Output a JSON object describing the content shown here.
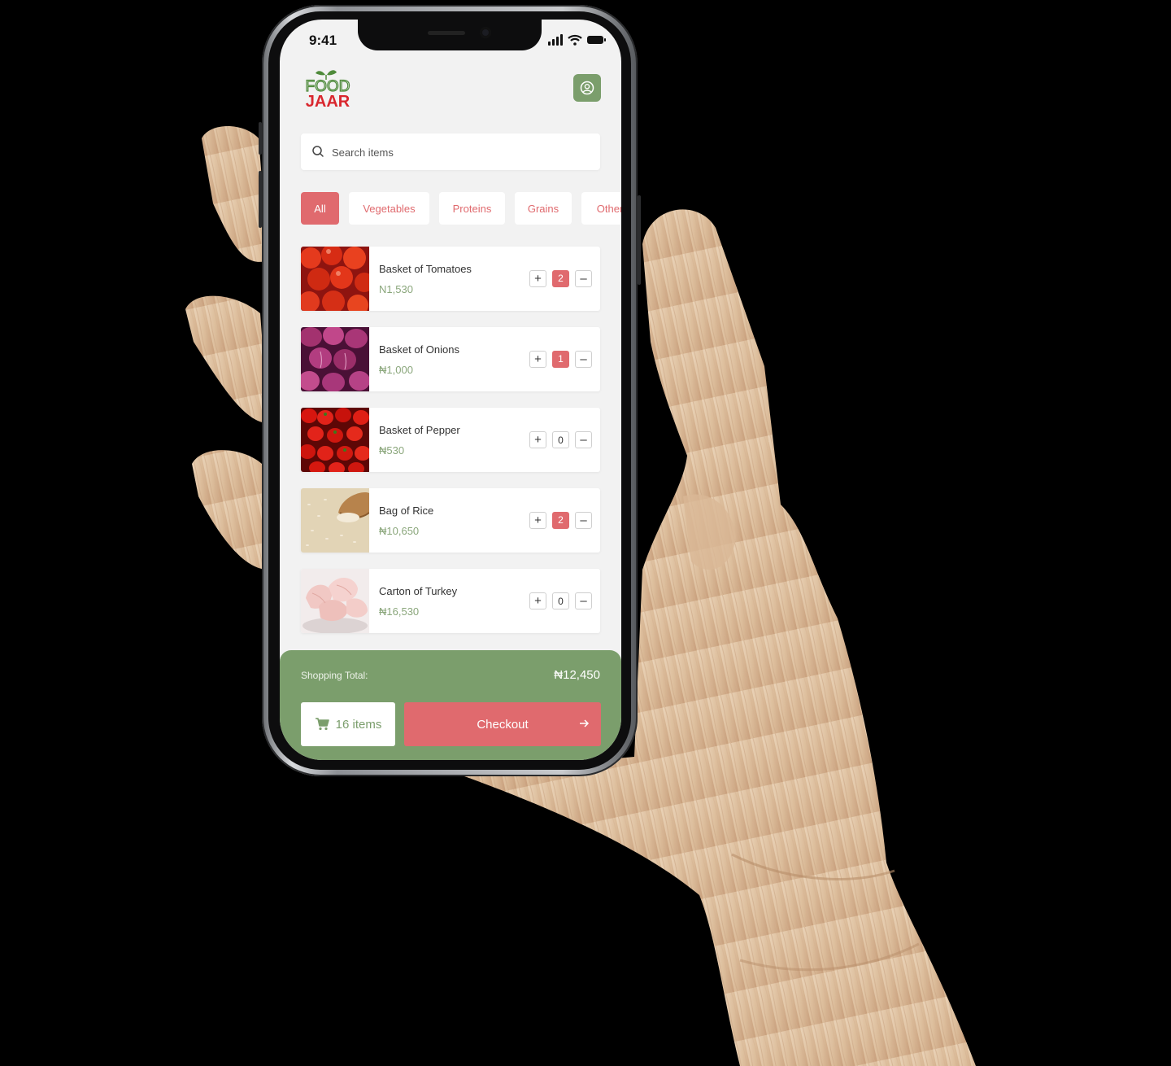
{
  "status_bar": {
    "time": "9:41"
  },
  "header": {
    "logo_top": "FOOD",
    "logo_bottom": "JAAR"
  },
  "search": {
    "placeholder": "Search items"
  },
  "categories": [
    {
      "label": "All",
      "active": true
    },
    {
      "label": "Vegetables",
      "active": false
    },
    {
      "label": "Proteins",
      "active": false
    },
    {
      "label": "Grains",
      "active": false
    },
    {
      "label": "Other",
      "active": false
    }
  ],
  "products": [
    {
      "name": "Basket of Tomatoes",
      "price": "N1,530",
      "qty": "2",
      "image": "tomatoes"
    },
    {
      "name": "Basket of Onions",
      "price": "₦1,000",
      "qty": "1",
      "image": "onions"
    },
    {
      "name": "Basket of Pepper",
      "price": "₦530",
      "qty": "0",
      "image": "pepper"
    },
    {
      "name": "Bag of Rice",
      "price": "₦10,650",
      "qty": "2",
      "image": "rice"
    },
    {
      "name": "Carton of Turkey",
      "price": "₦16,530",
      "qty": "0",
      "image": "turkey"
    }
  ],
  "stepper": {
    "plus": "+",
    "minus": "–"
  },
  "footer": {
    "total_label": "Shopping Total:",
    "total_value": "₦12,450",
    "items_label": "16 items",
    "checkout_label": "Checkout"
  },
  "colors": {
    "accent_red": "#e06a6e",
    "accent_green": "#7b9e6c",
    "price_green": "#8aa67b"
  }
}
